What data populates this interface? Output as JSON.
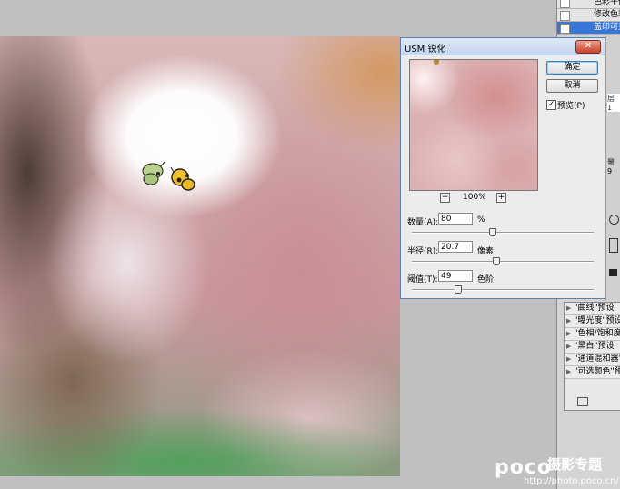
{
  "layers": [
    {
      "label": "色彩平衡",
      "selected": false
    },
    {
      "label": "修改色彩",
      "selected": false
    },
    {
      "label": "盖印可见图层",
      "selected": true
    }
  ],
  "dialog": {
    "title": "USM 锐化",
    "close_symbol": "✕",
    "ok_label": "确定",
    "cancel_label": "取消",
    "preview_checked": true,
    "preview_check_symbol": "✓",
    "preview_label": "预览(P)",
    "zoom": {
      "minus": "−",
      "plus": "+",
      "level": "100%"
    },
    "amount": {
      "label": "数量(A):",
      "value": "80",
      "unit": "%",
      "slider_fraction": 0.44
    },
    "radius": {
      "label": "半径(R):",
      "value": "20.7",
      "unit": "像素",
      "slider_fraction": 0.46
    },
    "threshold": {
      "label": "阈值(T):",
      "value": "49",
      "unit": "色阶",
      "slider_fraction": 0.25
    }
  },
  "side_panel_labels": {
    "layer_a": "层 1",
    "layer_b": "景 9",
    "preset_header": "P"
  },
  "presets": [
    "\"曲线\"预设",
    "\"曝光度\"预设",
    "\"色相/饱和度\"预设",
    "\"黑白\"预设",
    "\"通道混和器\"预设",
    "\"可选颜色\"预设"
  ],
  "watermark": {
    "brand": "poco",
    "cn": "摄影专题",
    "url": "http://photo.poco.cn/"
  },
  "colors": {
    "selection": "#3876d8",
    "canvas_bg": "#c0c0c0",
    "dialog_border": "#5a7fb0"
  }
}
